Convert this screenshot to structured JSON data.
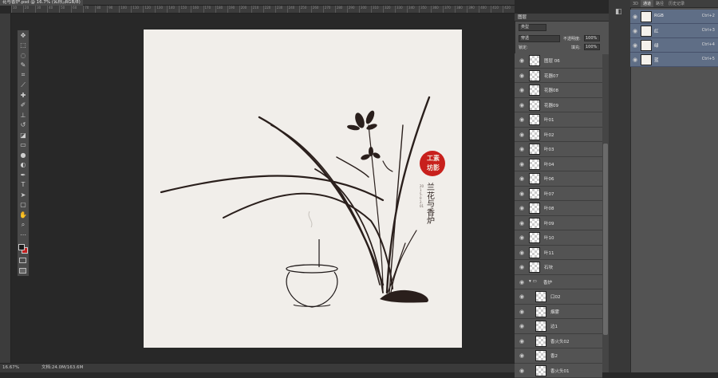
{
  "document": {
    "tab_title": "花与香炉.psd @ 16.7% (名称, RGB/8)",
    "tab_close": "×",
    "zoom": "16.67%",
    "doc_size": "文档:24.0M/163.6M"
  },
  "ruler": {
    "marks": [
      "10",
      "20",
      "30",
      "40",
      "50",
      "60",
      "70",
      "80",
      "90",
      "100",
      "110",
      "120",
      "130",
      "140",
      "150",
      "160",
      "170",
      "180",
      "190",
      "200",
      "210",
      "220",
      "230",
      "240",
      "250",
      "260",
      "270",
      "280",
      "290",
      "300",
      "310",
      "320",
      "330",
      "340",
      "350",
      "360",
      "370",
      "380",
      "390",
      "400",
      "410",
      "420"
    ]
  },
  "artwork": {
    "seal_text_1": "工",
    "seal_text_2": "素",
    "seal_text_3": "坊",
    "seal_text_4": "影",
    "vertical_title": "兰花与香炉",
    "small_text": "2015.02.01"
  },
  "layers_panel": {
    "title": "图层",
    "filter": "类型",
    "blend_mode": "穿透",
    "opacity_label": "不透明度:",
    "opacity_value": "100%",
    "lock_label": "锁定:",
    "fill_label": "填充:",
    "fill_value": "100%",
    "layers": [
      "图层 06",
      "花器07",
      "花器08",
      "花器09",
      "叶01",
      "叶02",
      "叶03",
      "叶04",
      "叶06",
      "叶07",
      "叶08",
      "叶09",
      "叶10",
      "叶11",
      "石块",
      "香炉",
      "口02",
      "烟雾",
      "边1",
      "香火头02",
      "香2",
      "香火头01"
    ]
  },
  "channels_panel": {
    "tabs": [
      "3D",
      "通道",
      "路径",
      "历史记录"
    ],
    "channels": [
      {
        "name": "RGB",
        "shortcut": "Ctrl+2"
      },
      {
        "name": "红",
        "shortcut": "Ctrl+3"
      },
      {
        "name": "绿",
        "shortcut": "Ctrl+4"
      },
      {
        "name": "蓝",
        "shortcut": "Ctrl+5"
      }
    ]
  },
  "colors": {
    "foreground": "#1a1a1a",
    "background": "#c21f1f",
    "seal": "#c8201c",
    "canvas": "#f1eeea"
  },
  "icons": [
    "move-icon",
    "marquee-icon",
    "lasso-icon",
    "quick-select-icon",
    "crop-icon",
    "eyedropper-icon",
    "heal-icon",
    "brush-icon",
    "stamp-icon",
    "history-brush-icon",
    "eraser-icon",
    "gradient-icon",
    "blur-icon",
    "dodge-icon",
    "pen-icon",
    "type-icon",
    "path-select-icon",
    "shape-icon",
    "hand-icon",
    "zoom-icon",
    "eye-icon"
  ]
}
